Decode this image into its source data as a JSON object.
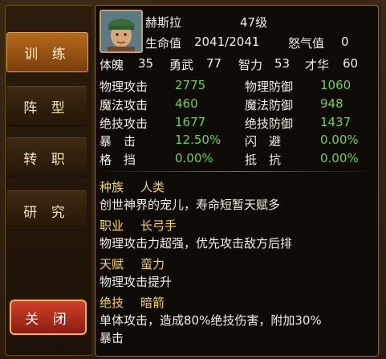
{
  "nav": {
    "items": [
      "训 练",
      "阵 型",
      "转 职",
      "研 究"
    ],
    "close": "关 闭"
  },
  "hero": {
    "name": "赫斯拉",
    "level": "47级",
    "hp_label": "生命值",
    "hp": "2041/2041",
    "rage_label": "怒气值",
    "rage": "0"
  },
  "attrs": [
    {
      "label": "体魄",
      "value": "35"
    },
    {
      "label": "勇武",
      "value": "77"
    },
    {
      "label": "智力",
      "value": "53"
    },
    {
      "label": "才华",
      "value": "60"
    }
  ],
  "stats": [
    {
      "l1": "物理攻击",
      "v1": "2775",
      "l2": "物理防御",
      "v2": "1060"
    },
    {
      "l1": "魔法攻击",
      "v1": "460",
      "l2": "魔法防御",
      "v2": "948"
    },
    {
      "l1": "绝技攻击",
      "v1": "1677",
      "l2": "绝技防御",
      "v2": "1437"
    },
    {
      "l1": "暴　击",
      "v1": "12.50%",
      "l2": "闪　避",
      "v2": "0.00%"
    },
    {
      "l1": "格　挡",
      "v1": "0.00%",
      "l2": "抵　抗",
      "v2": "0.00%"
    }
  ],
  "race": {
    "label": "种族",
    "value": "人类",
    "desc": "创世神界的宠儿，寿命短暂天赋多"
  },
  "job": {
    "label": "职业",
    "value": "长弓手",
    "desc": "物理攻击力超强，优先攻击敌方后排"
  },
  "talent": {
    "label": "天赋",
    "value": "蛮力",
    "desc": "物理攻击提升"
  },
  "skill": {
    "label": "绝技",
    "value": "暗箭",
    "desc1": "单体攻击，造成80%绝技伤害，附加30%",
    "desc2": "暴击"
  },
  "colors": {
    "accent": "#f3d55a",
    "stat_value": "#6fd14a",
    "text": "#f4eee0"
  }
}
